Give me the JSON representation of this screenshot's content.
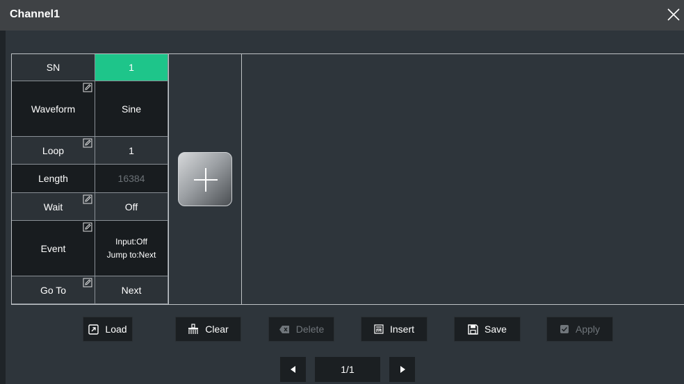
{
  "window": {
    "title": "Channel1"
  },
  "table": {
    "sn_label": "SN",
    "sn_value": "1",
    "rows": [
      {
        "label": "Waveform",
        "value": "Sine",
        "editable": true
      },
      {
        "label": "Loop",
        "value": "1",
        "editable": true
      },
      {
        "label": "Length",
        "value": "16384",
        "editable": false
      },
      {
        "label": "Wait",
        "value": "Off",
        "editable": true
      },
      {
        "label": "Event",
        "value_line1": "Input:Off",
        "value_line2": "Jump to:Next",
        "editable": true
      },
      {
        "label": "Go To",
        "value": "Next",
        "editable": true
      }
    ]
  },
  "toolbar": {
    "load": "Load",
    "clear": "Clear",
    "delete": "Delete",
    "insert": "Insert",
    "save": "Save",
    "apply": "Apply"
  },
  "pager": {
    "page": "1/1"
  },
  "colors": {
    "accent_green": "#1ec58a",
    "background": "#2e353b",
    "titlebar": "#3f4245"
  },
  "icons": {
    "close": "close-icon",
    "edit": "edit-icon",
    "add": "plus-icon",
    "load": "load-icon",
    "clear": "broom-icon",
    "delete": "backspace-icon",
    "insert": "insert-icon",
    "save": "floppy-icon",
    "apply": "check-icon",
    "prev": "triangle-left-icon",
    "next": "triangle-right-icon"
  }
}
